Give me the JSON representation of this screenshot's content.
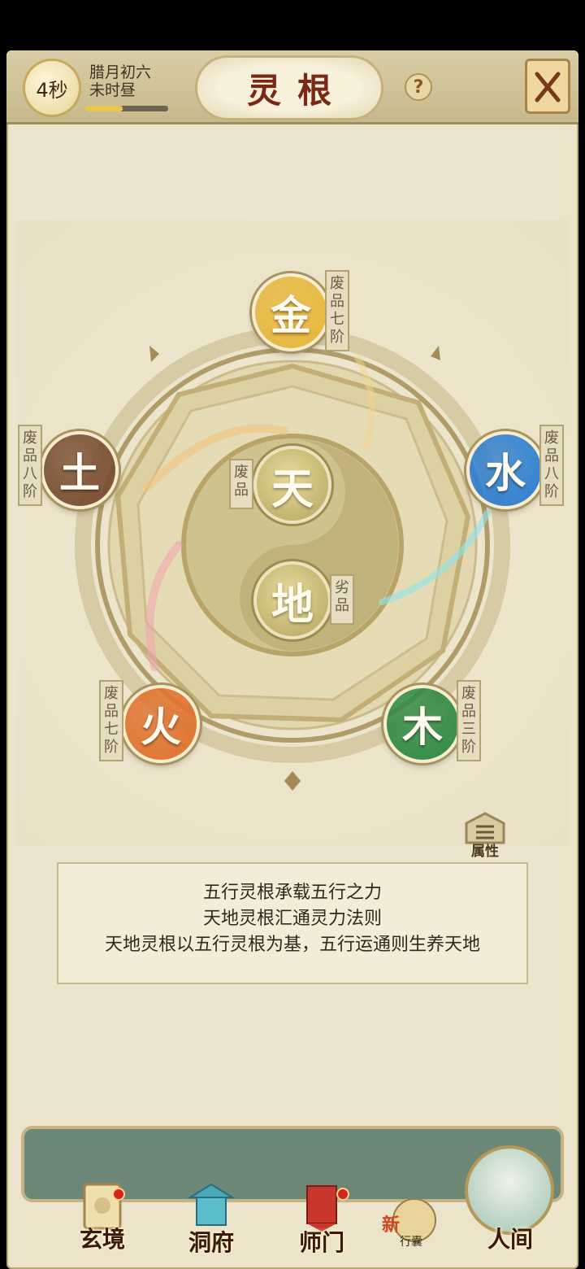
{
  "header": {
    "timer": "4秒",
    "date_line1": "腊月初六",
    "date_line2": "未时昼",
    "progress": 0.45,
    "title": "灵根",
    "help_label": "?"
  },
  "elements": {
    "metal": {
      "char": "金",
      "grade": "废品",
      "level": "七阶",
      "color": "#e8b83c"
    },
    "water": {
      "char": "水",
      "grade": "废品",
      "level": "八阶",
      "color": "#2f7fd0"
    },
    "wood": {
      "char": "木",
      "grade": "废品",
      "level": "三阶",
      "color": "#2f8a44"
    },
    "fire": {
      "char": "火",
      "grade": "废品",
      "level": "七阶",
      "color": "#e0722e"
    },
    "earth": {
      "char": "土",
      "grade": "废品",
      "level": "八阶",
      "color": "#7a4e32"
    }
  },
  "core": {
    "heaven": {
      "char": "天",
      "grade": "废品"
    },
    "earth": {
      "char": "地",
      "grade": "劣品"
    }
  },
  "attributes_button": {
    "label": "属性"
  },
  "info": {
    "line1": "五行灵根承载五行之力",
    "line2": "天地灵根汇通灵力法则",
    "line3": "天地灵根以五行灵根为基，五行运通则生养天地"
  },
  "nav": {
    "items": [
      {
        "label": "玄境",
        "badge": true
      },
      {
        "label": "洞府",
        "badge": false
      },
      {
        "label": "师门",
        "badge": true
      },
      {
        "label": "新",
        "sub": "行囊"
      },
      {
        "label": "人间"
      }
    ]
  }
}
